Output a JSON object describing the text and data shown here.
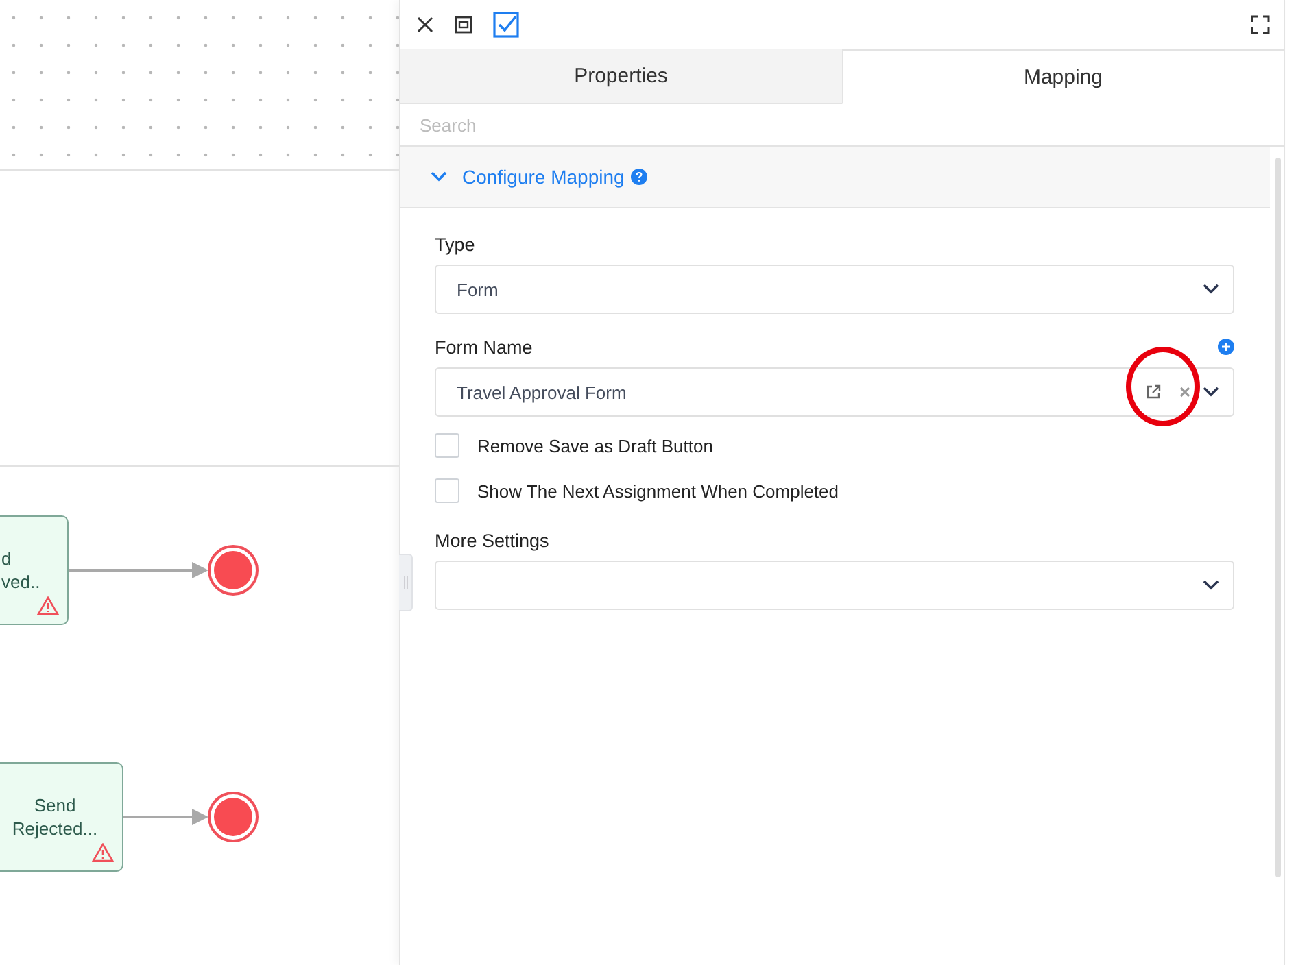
{
  "diagram": {
    "nodes": [
      {
        "lines": [
          "d",
          "ved.."
        ],
        "warning": true
      },
      {
        "lines": [
          "Send",
          "Rejected..."
        ],
        "warning": true
      }
    ]
  },
  "tabs": [
    {
      "label": "Properties",
      "selected": false
    },
    {
      "label": "Mapping",
      "selected": true
    }
  ],
  "search": {
    "placeholder": "Search"
  },
  "section": {
    "title": "Configure Mapping",
    "expanded": true
  },
  "fields": [
    {
      "kind": "select",
      "label": "Type",
      "value": "Form"
    },
    {
      "kind": "lookup",
      "label": "Form Name",
      "value": "Travel Approval Form"
    },
    {
      "kind": "checkbox",
      "label": "Remove Save as Draft Button",
      "checked": false
    },
    {
      "kind": "checkbox",
      "label": "Show The Next Assignment When Completed",
      "checked": false
    },
    {
      "kind": "select",
      "label": "More Settings"
    }
  ]
}
